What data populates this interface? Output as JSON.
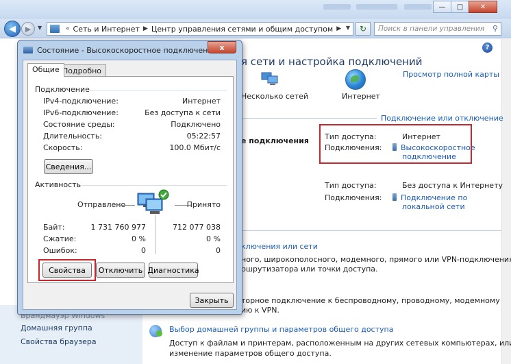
{
  "explorer": {
    "address_crumbs": [
      "Сеть и Интернет",
      "Центр управления сетями и общим доступом"
    ],
    "search_placeholder": "Поиск в панели управления",
    "content_title": "я сети и настройка подключений",
    "map_link": "Просмотр полной карты",
    "node_network_label": "Несколько сетей",
    "node_internet_label": "Интернет",
    "connect_link": "Подключение или отключение",
    "network1": {
      "name": "е подключения",
      "access_type_label": "Тип доступа:",
      "access_type_value": "Интернет",
      "connections_label": "Подключения:",
      "connection_link_line1": "Высокоскоростное",
      "connection_link_line2": "подключение"
    },
    "network2": {
      "access_type_label": "Тип доступа:",
      "access_type_value": "Без доступа к Интернету",
      "connections_label": "Подключения:",
      "connection_link_line1": "Подключение по",
      "connection_link_line2": "локальной сети"
    },
    "tasks": {
      "setup_link": "ключения или сети",
      "setup_desc1": "ного, широкополосного, модемного, прямого или VPN-подключения",
      "setup_desc2": "ршрутизатора или точки доступа.",
      "connect_desc1": "торное подключение к беспроводному, проводному, модемному",
      "connect_desc2": "ию к VPN.",
      "homegroup_link": "Выбор домашней группы и параметров общего доступа",
      "homegroup_desc1": "Доступ к файлам и принтерам, расположенным на других сетевых компьютерах, или",
      "homegroup_desc2": "изменение параметров общего доступа."
    },
    "sidebar": {
      "partial_item": "Брандмауэр Windows",
      "items": [
        "Домашняя группа",
        "Свойства браузера"
      ]
    }
  },
  "dialog": {
    "title": "Состояние - Высокоскоростное подключение",
    "close_symbol": "x",
    "tabs": [
      "Общие",
      "Подробно"
    ],
    "connection_group": "Подключение",
    "connection_rows": [
      {
        "key": "IPv4-подключение:",
        "value": "Интернет"
      },
      {
        "key": "IPv6-подключение:",
        "value": "Без доступа к сети"
      },
      {
        "key": "Состояние среды:",
        "value": "Подключено"
      },
      {
        "key": "Длительность:",
        "value": "05:22:57"
      },
      {
        "key": "Скорость:",
        "value": "100.0 Мбит/с"
      }
    ],
    "details_button": "Сведения...",
    "activity_group": "Активность",
    "sent_label": "Отправлено",
    "received_label": "Принято",
    "stats_rows": [
      {
        "key": "Байт:",
        "sent": "1 731 760 977",
        "received": "712 077 038"
      },
      {
        "key": "Сжатие:",
        "sent": "0 %",
        "received": "0 %"
      },
      {
        "key": "Ошибок:",
        "sent": "0",
        "received": "0"
      }
    ],
    "buttons": {
      "properties": "Свойства",
      "disconnect": "Отключить",
      "diagnostics": "Диагностика",
      "close": "Закрыть"
    }
  }
}
